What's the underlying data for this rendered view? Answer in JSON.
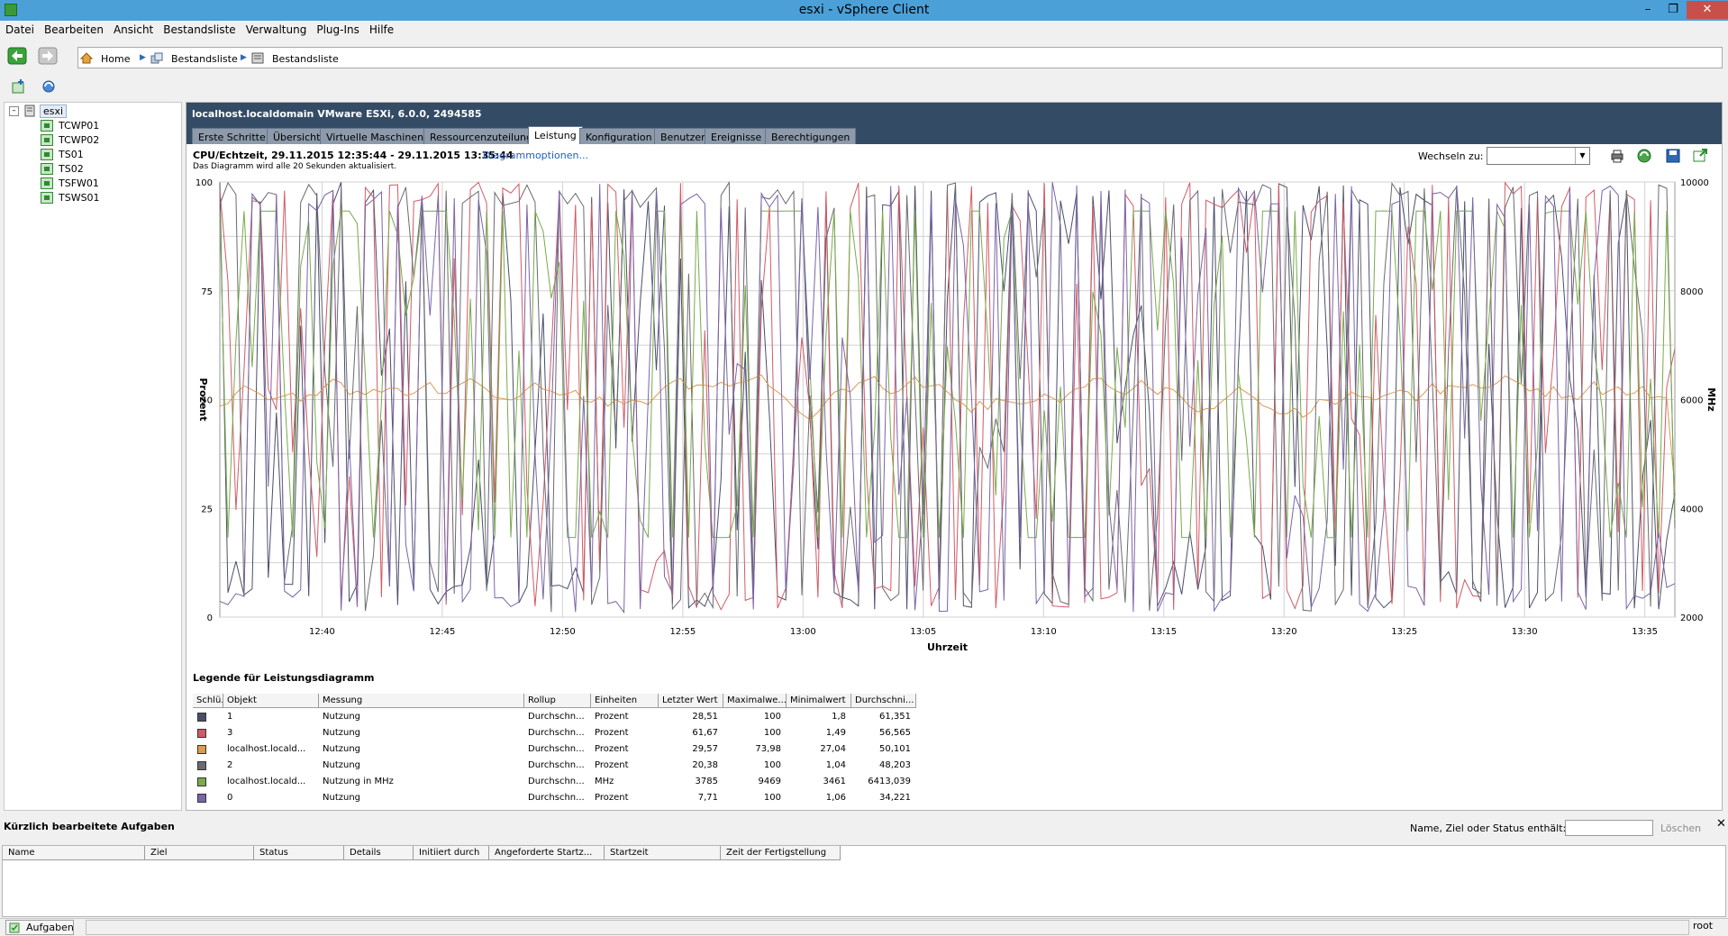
{
  "window": {
    "title": "esxi - vSphere Client",
    "minimize": "–",
    "maximize": "❐",
    "close": "✕"
  },
  "menu": [
    "Datei",
    "Bearbeiten",
    "Ansicht",
    "Bestandsliste",
    "Verwaltung",
    "Plug-Ins",
    "Hilfe"
  ],
  "breadcrumb": {
    "home": "Home",
    "inventory1": "Bestandsliste",
    "inventory2": "Bestandsliste"
  },
  "tree": {
    "host": "esxi",
    "vms": [
      "TCWP01",
      "TCWP02",
      "TS01",
      "TS02",
      "TSFW01",
      "TSWS01"
    ]
  },
  "host_header": {
    "title": "localhost.localdomain VMware ESXi, 6.0.0, 2494585",
    "tabs": [
      "Erste Schritte",
      "Übersicht",
      "Virtuelle Maschinen",
      "Ressourcenzuteilung",
      "Leistung",
      "Konfiguration",
      "Benutzer",
      "Ereignisse",
      "Berechtigungen"
    ],
    "active_tab": "Leistung"
  },
  "chart_header": {
    "title": "CPU/Echtzeit, 29.11.2015 12:35:44 - 29.11.2015 13:35:44",
    "options_link": "Diagrammoptionen...",
    "subtitle": "Das Diagramm wird alle 20 Sekunden aktualisiert.",
    "switch_label": "Wechseln zu:",
    "switch_value": ""
  },
  "chart_data": {
    "type": "line",
    "xlabel": "Uhrzeit",
    "ylabel": "Prozent",
    "y2label": "MHz",
    "ylim": [
      0,
      100
    ],
    "y2lim": [
      2000,
      10000
    ],
    "yticks": [
      "0",
      "25",
      "50",
      "75",
      "100"
    ],
    "y2ticks": [
      "2000",
      "4000",
      "6000",
      "8000",
      "10000"
    ],
    "xlim_minutes": [
      -4.25,
      56.25
    ],
    "x_tick_minutes": [
      0,
      5,
      10,
      15,
      20,
      25,
      30,
      35,
      40,
      45,
      50,
      55
    ],
    "xticks": [
      "12:40",
      "12:45",
      "12:50",
      "12:55",
      "13:00",
      "13:05",
      "13:10",
      "13:15",
      "13:20",
      "13:25",
      "13:30",
      "13:35"
    ],
    "grid": true,
    "series": [
      {
        "name": "1",
        "color": "#4a4e6a",
        "axis": "left",
        "last": 28.51,
        "min": 1.8,
        "max": 100,
        "avg": 61.351
      },
      {
        "name": "3",
        "color": "#d25a65",
        "axis": "left",
        "last": 61.67,
        "min": 1.49,
        "max": 100,
        "avg": 56.565
      },
      {
        "name": "localhost.localdomain",
        "color": "#e0994f",
        "axis": "left",
        "last": 29.57,
        "min": 27.04,
        "max": 73.98,
        "avg": 50.101
      },
      {
        "name": "2",
        "color": "#6a6a72",
        "axis": "left",
        "last": 20.38,
        "min": 1.04,
        "max": 100,
        "avg": 48.203
      },
      {
        "name": "localhost.localdomain",
        "color": "#78ab4a",
        "axis": "right",
        "last": 3785,
        "min": 3461,
        "max": 9469,
        "avg": 6413.039
      },
      {
        "name": "0",
        "color": "#7b64a8",
        "axis": "left",
        "last": 7.71,
        "min": 1.06,
        "max": 100,
        "avg": 34.221
      }
    ]
  },
  "legend": {
    "title": "Legende für Leistungsdiagramm",
    "columns": [
      "Schlü...",
      "Objekt",
      "Messung",
      "Rollup",
      "Einheiten",
      "Letzter Wert",
      "Maximalwe...",
      "Minimalwert",
      "Durchschni..."
    ],
    "rows": [
      {
        "color": "#4a4e6a",
        "object": "1",
        "measure": "Nutzung",
        "rollup": "Durchschn...",
        "unit": "Prozent",
        "last": "28,51",
        "max": "100",
        "min": "1,8",
        "avg": "61,351"
      },
      {
        "color": "#d25a65",
        "object": "3",
        "measure": "Nutzung",
        "rollup": "Durchschn...",
        "unit": "Prozent",
        "last": "61,67",
        "max": "100",
        "min": "1,49",
        "avg": "56,565"
      },
      {
        "color": "#e0994f",
        "object": "localhost.locald...",
        "measure": "Nutzung",
        "rollup": "Durchschn...",
        "unit": "Prozent",
        "last": "29,57",
        "max": "73,98",
        "min": "27,04",
        "avg": "50,101"
      },
      {
        "color": "#6a6a72",
        "object": "2",
        "measure": "Nutzung",
        "rollup": "Durchschn...",
        "unit": "Prozent",
        "last": "20,38",
        "max": "100",
        "min": "1,04",
        "avg": "48,203"
      },
      {
        "color": "#78ab4a",
        "object": "localhost.locald...",
        "measure": "Nutzung in MHz",
        "rollup": "Durchschn...",
        "unit": "MHz",
        "last": "3785",
        "max": "9469",
        "min": "3461",
        "avg": "6413,039"
      },
      {
        "color": "#7b64a8",
        "object": "0",
        "measure": "Nutzung",
        "rollup": "Durchschn...",
        "unit": "Prozent",
        "last": "7,71",
        "max": "100",
        "min": "1,06",
        "avg": "34,221"
      }
    ]
  },
  "tasks": {
    "title": "Kürzlich bearbeitete Aufgaben",
    "filter_label": "Name, Ziel oder Status enthält: ▾",
    "filter_value": "",
    "clear": "Löschen",
    "close": "✕",
    "columns": [
      "Name",
      "Ziel",
      "Status",
      "Details",
      "Initiiert durch",
      "Angeforderte Startz...",
      "Startzeit",
      "Zeit der Fertigstellung"
    ]
  },
  "statusbar": {
    "tasks_button": "Aufgaben",
    "user": "root"
  }
}
